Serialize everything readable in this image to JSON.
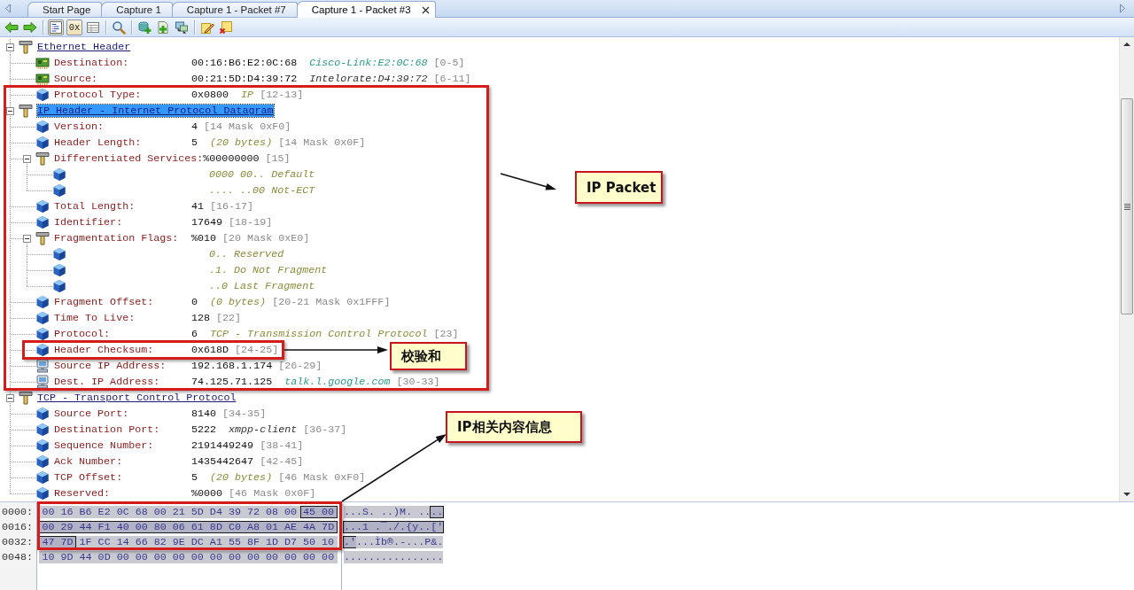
{
  "tabs": [
    {
      "label": "Start Page",
      "selected": false
    },
    {
      "label": "Capture 1",
      "selected": false
    },
    {
      "label": "Capture 1 - Packet #7",
      "selected": false
    },
    {
      "label": "Capture 1 - Packet #3",
      "selected": true
    }
  ],
  "toolbar": [
    {
      "buttons": [
        {
          "kind": "back",
          "pressed": false
        },
        {
          "kind": "forward",
          "pressed": false
        }
      ]
    },
    {
      "buttons": [
        {
          "kind": "tree",
          "pressed": true
        },
        {
          "kind": "hex",
          "label": "0x",
          "pressed": true
        },
        {
          "kind": "table",
          "pressed": false
        }
      ]
    },
    {
      "buttons": [
        {
          "kind": "search",
          "pressed": false
        }
      ]
    },
    {
      "buttons": [
        {
          "kind": "stack_add",
          "pressed": false
        },
        {
          "kind": "page_add",
          "pressed": false
        },
        {
          "kind": "network",
          "pressed": false
        }
      ]
    },
    {
      "buttons": [
        {
          "kind": "edit",
          "pressed": false
        },
        {
          "kind": "clear",
          "pressed": false
        }
      ]
    }
  ],
  "tree": [
    {
      "kind": "section",
      "label": "Ethernet Header",
      "expanded": true,
      "selected": false,
      "children": [
        {
          "kind": "hardware",
          "label": "Destination:",
          "value": "00:16:B6:E2:0C:68",
          "detail": {
            "kind": "name",
            "text": "Cisco-Link:E2:0C:68"
          },
          "range": "[0-5]",
          "selected": false
        },
        {
          "kind": "hardware",
          "label": "Source:",
          "value": "00:21:5D:D4:39:72",
          "detail": {
            "kind": "vendor",
            "text": "Intelorate:D4:39:72"
          },
          "range": "[6-11]",
          "selected": false
        },
        {
          "kind": "field",
          "label": "Protocol Type:",
          "value": "0x0800",
          "detail": {
            "kind": "note",
            "text": "IP"
          },
          "range": "[12-13]",
          "selected": false
        }
      ]
    },
    {
      "kind": "section",
      "label": "IP Header - Internet Protocol Datagram",
      "expanded": true,
      "selected": true,
      "children": [
        {
          "kind": "field",
          "label": "Version:",
          "value": "4",
          "range": "[14 Mask 0xF0]",
          "selected": false
        },
        {
          "kind": "field",
          "label": "Header Length:",
          "value": "5",
          "detail": {
            "kind": "note",
            "text": "(20 bytes)"
          },
          "range": "[14 Mask 0x0F]",
          "selected": false
        },
        {
          "kind": "field",
          "label": "Differentiated Services:",
          "value": "%00000000",
          "range": "[15]",
          "expanded": true,
          "selected": false,
          "children": [
            {
              "kind": "bits",
              "text": "0000 00.. Default",
              "selected": false
            },
            {
              "kind": "bits",
              "text": ".... ..00 Not-ECT",
              "selected": false
            }
          ]
        },
        {
          "kind": "field",
          "label": "Total Length:",
          "value": "41",
          "range": "[16-17]",
          "selected": false
        },
        {
          "kind": "field",
          "label": "Identifier:",
          "value": "17649",
          "range": "[18-19]",
          "selected": false
        },
        {
          "kind": "field",
          "label": "Fragmentation Flags:",
          "value": "%010",
          "range": "[20 Mask 0xE0]",
          "expanded": true,
          "selected": false,
          "children": [
            {
              "kind": "bits",
              "text": "0.. Reserved",
              "selected": false
            },
            {
              "kind": "bits",
              "text": ".1. Do Not Fragment",
              "selected": false
            },
            {
              "kind": "bits",
              "text": "..0 Last Fragment",
              "selected": false
            }
          ]
        },
        {
          "kind": "field",
          "label": "Fragment Offset:",
          "value": "0",
          "detail": {
            "kind": "note",
            "text": "(0 bytes)"
          },
          "range": "[20-21 Mask 0x1FFF]",
          "selected": false
        },
        {
          "kind": "field",
          "label": "Time To Live:",
          "value": "128",
          "range": "[22]",
          "selected": false
        },
        {
          "kind": "field",
          "label": "Protocol:",
          "value": "6",
          "detail": {
            "kind": "note",
            "text": "TCP - Transmission Control Protocol"
          },
          "range": "[23]",
          "selected": false
        },
        {
          "kind": "field",
          "label": "Header Checksum:",
          "value": "0x618D",
          "range": "[24-25]",
          "selected": false
        },
        {
          "kind": "host",
          "label": "Source IP Address:",
          "value": "192.168.1.174",
          "range": "[26-29]",
          "selected": false
        },
        {
          "kind": "host",
          "label": "Dest. IP Address:",
          "value": "74.125.71.125",
          "detail": {
            "kind": "name",
            "text": "talk.l.google.com"
          },
          "range": "[30-33]",
          "selected": false
        }
      ]
    },
    {
      "kind": "section",
      "label": "TCP - Transport Control Protocol",
      "expanded": true,
      "selected": false,
      "children": [
        {
          "kind": "field",
          "label": "Source Port:",
          "value": "8140",
          "range": "[34-35]",
          "selected": false
        },
        {
          "kind": "field",
          "label": "Destination Port:",
          "value": "5222",
          "detail": {
            "kind": "vendor",
            "text": "xmpp-client"
          },
          "range": "[36-37]",
          "selected": false
        },
        {
          "kind": "field",
          "label": "Sequence Number:",
          "value": "2191449249",
          "range": "[38-41]",
          "selected": false
        },
        {
          "kind": "field",
          "label": "Ack Number:",
          "value": "1435442647",
          "range": "[42-45]",
          "selected": false
        },
        {
          "kind": "field",
          "label": "TCP Offset:",
          "value": "5",
          "detail": {
            "kind": "note",
            "text": "(20 bytes)"
          },
          "range": "[46 Mask 0xF0]",
          "selected": false
        },
        {
          "kind": "field",
          "label": "Reserved:",
          "value": "%0000",
          "range": "[46 Mask 0x0F]",
          "selected": false
        }
      ]
    }
  ],
  "hex_rows": [
    {
      "offset": "0000:",
      "hex": [
        {
          "text": "00 16 B6 E2 0C 68 00 21 5D D4 39 72 08 00",
          "selected": false
        },
        {
          "text": "45 00",
          "selected": true
        }
      ],
      "ascii": [
        {
          "text": "...S. ..)M. ..",
          "selected": false
        },
        {
          "text": "..",
          "selected": true
        }
      ]
    },
    {
      "offset": "0016:",
      "hex": [
        {
          "text": "00 29 44 F1 40 00 80 06 61 8D C0 A8 01 AE 4A 7D",
          "selected": true
        }
      ],
      "ascii": [
        {
          "text": "...1 .¯./.{y..['",
          "selected": true
        }
      ]
    },
    {
      "offset": "0032:",
      "hex": [
        {
          "text": "47 7D",
          "selected": true
        },
        {
          "text": "1F CC 14 66 82 9E DC A1 55 8F 1D D7 50 10",
          "selected": false
        }
      ],
      "ascii": [
        {
          "text": ".'",
          "selected": true
        },
        {
          "text": "...Ìb®.-...P&.",
          "selected": false
        }
      ]
    },
    {
      "offset": "0048:",
      "hex": [
        {
          "text": "10 9D 44 0D 00 00 00 00 00 00 00 00 00 00 00 00",
          "selected": false
        }
      ],
      "ascii": [
        {
          "text": "................",
          "selected": false
        }
      ]
    }
  ],
  "callouts": [
    {
      "text": "IP Packet"
    },
    {
      "text": "校验和"
    },
    {
      "text": "IP相关内容信息"
    }
  ]
}
